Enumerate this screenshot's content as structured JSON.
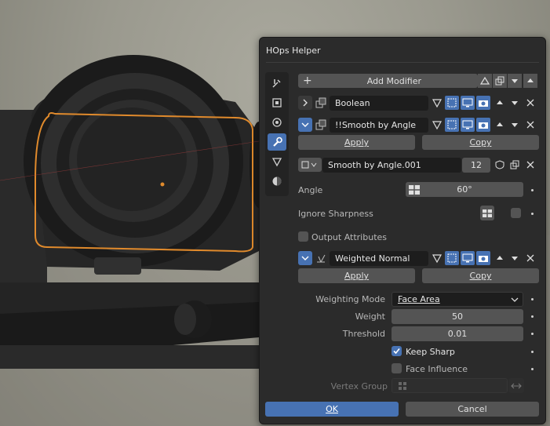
{
  "panel": {
    "title": "HOps Helper"
  },
  "add_modifier": {
    "label": "Add Modifier"
  },
  "modifiers": [
    {
      "name": "Boolean",
      "collapsed": true
    },
    {
      "name": "!!Smooth by Angle",
      "apply_label": "Apply",
      "copy_label": "Copy",
      "node_group": "Smooth by Angle.001",
      "users": "12",
      "angle_label": "Angle",
      "angle_value": "60°",
      "ignore_sharpness_label": "Ignore Sharpness",
      "output_attributes_label": "Output Attributes"
    },
    {
      "name": "Weighted Normal",
      "apply_label": "Apply",
      "copy_label": "Copy",
      "weighting_mode_label": "Weighting Mode",
      "weighting_mode_value": "Face Area",
      "weight_label": "Weight",
      "weight_value": "50",
      "threshold_label": "Threshold",
      "threshold_value": "0.01",
      "keep_sharp_label": "Keep Sharp",
      "keep_sharp_checked": true,
      "face_influence_label": "Face Influence",
      "face_influence_checked": false,
      "vertex_group_label": "Vertex Group",
      "vertex_group_value": ""
    }
  ],
  "footer": {
    "ok_label": "OK",
    "cancel_label": "Cancel"
  },
  "colors": {
    "accent": "#4772b3",
    "panel_bg": "#2b2b2b",
    "widget": "#545454",
    "selection_outline": "#e08a2c"
  },
  "tab_icons": [
    "tool-icon",
    "object-icon",
    "physics-icon",
    "wrench-icon",
    "vertex-data-icon",
    "material-icon"
  ]
}
